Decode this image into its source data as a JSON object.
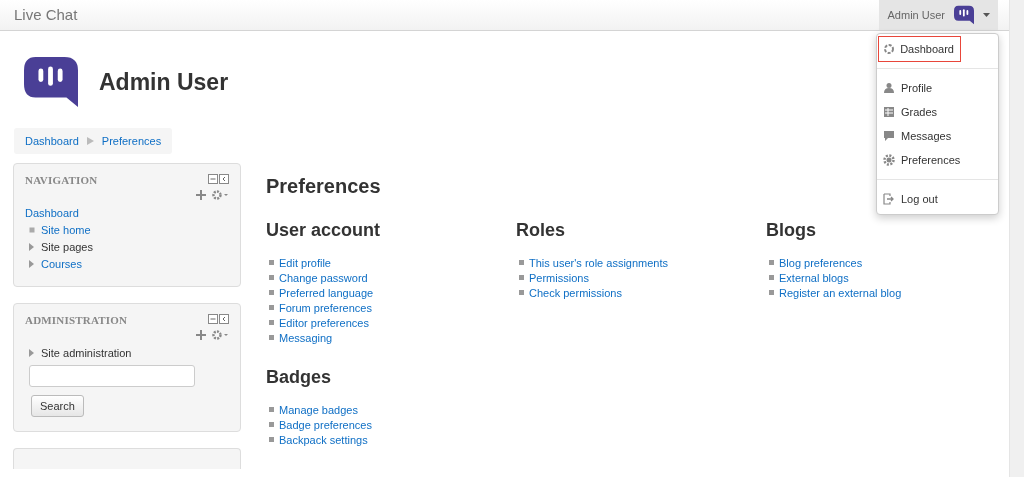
{
  "navbar": {
    "brand": "Live Chat",
    "user_name": "Admin User"
  },
  "user_menu": {
    "expanded": true,
    "items": [
      {
        "label": "Dashboard",
        "kind": "dashboard",
        "highlighted": true
      },
      {
        "label": "Profile",
        "kind": "profile",
        "highlighted": false
      },
      {
        "label": "Grades",
        "kind": "grades",
        "highlighted": false
      },
      {
        "label": "Messages",
        "kind": "messages",
        "highlighted": false
      },
      {
        "label": "Preferences",
        "kind": "preferences",
        "highlighted": false
      },
      {
        "label": "Log out",
        "kind": "logout",
        "highlighted": false
      }
    ]
  },
  "header": {
    "title": "Admin User"
  },
  "breadcrumb": [
    "Dashboard",
    "Preferences"
  ],
  "blocks": [
    {
      "title": "NAVIGATION",
      "kind": "tree",
      "items": [
        {
          "label": "Dashboard",
          "kind": "root",
          "link": true
        },
        {
          "label": "Site home",
          "kind": "leaf",
          "link": true
        },
        {
          "label": "Site pages",
          "kind": "branch",
          "link": false,
          "expanded": false
        },
        {
          "label": "Courses",
          "kind": "branch",
          "link": true,
          "expanded": false
        }
      ]
    },
    {
      "title": "ADMINISTRATION",
      "kind": "search",
      "items": [
        {
          "label": "Site administration",
          "kind": "branch",
          "link": false,
          "expanded": false
        }
      ],
      "button": "Search"
    }
  ],
  "main": {
    "title": "Preferences",
    "sections": [
      {
        "title": "User account",
        "links": [
          "Edit profile",
          "Change password",
          "Preferred language",
          "Forum preferences",
          "Editor preferences",
          "Messaging"
        ]
      },
      {
        "title": "Roles",
        "links": [
          "This user's role assignments",
          "Permissions",
          "Check permissions"
        ]
      },
      {
        "title": "Blogs",
        "links": [
          "Blog preferences",
          "External blogs",
          "Register an external blog"
        ]
      },
      {
        "title": "Badges",
        "links": [
          "Manage badges",
          "Badge preferences",
          "Backpack settings"
        ]
      }
    ]
  }
}
